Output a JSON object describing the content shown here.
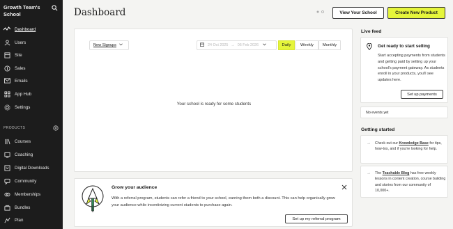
{
  "sidebar": {
    "school_name": "Growth Team's School",
    "items": [
      {
        "label": "Dashboard",
        "icon": "activity-icon",
        "active": true
      },
      {
        "label": "Users",
        "icon": "users-icon"
      },
      {
        "label": "Site",
        "icon": "site-icon"
      },
      {
        "label": "Sales",
        "icon": "sales-icon"
      },
      {
        "label": "Emails",
        "icon": "mail-icon"
      },
      {
        "label": "App Hub",
        "icon": "app-hub-icon"
      },
      {
        "label": "Settings",
        "icon": "gear-icon"
      }
    ],
    "products_header": "PRODUCTS",
    "products": [
      {
        "label": "Courses",
        "icon": "courses-icon"
      },
      {
        "label": "Coaching",
        "icon": "coaching-icon"
      },
      {
        "label": "Digital Downloads",
        "icon": "download-icon"
      },
      {
        "label": "Community",
        "icon": "community-icon"
      },
      {
        "label": "Memberships",
        "icon": "memberships-icon"
      },
      {
        "label": "Bundles",
        "icon": "bundles-icon"
      },
      {
        "label": "Plan",
        "icon": "plan-icon"
      }
    ]
  },
  "header": {
    "title": "Dashboard",
    "view_school": "View Your School",
    "create_product": "Create New Product"
  },
  "chart": {
    "metric": "New Signups",
    "date_start": "24 Oct 2025",
    "date_sep": "→",
    "date_end": "06 Feb 2026",
    "periods": [
      "Daily",
      "Weekly",
      "Monthly"
    ],
    "active_period": "Daily",
    "empty_message": "Your school is ready for some students"
  },
  "grow": {
    "title": "Grow your audience",
    "description": "With a referral program, students can refer a friend to your school, earning them both a discount. This can help organically grow your audience while incentivizing current students to purchase again.",
    "button": "Set up my referral program"
  },
  "live_feed": {
    "title": "Live feed",
    "card_title": "Get ready to start selling",
    "card_text": "Start accepting payments from students and getting paid by setting up your school's payment gateway. As students enroll in your products, you'll see updates here.",
    "card_button": "Set up payments",
    "events_text": "No events yet"
  },
  "getting_started": {
    "title": "Getting started",
    "item1_pre": "Check out our ",
    "item1_link": "Knowledge Base",
    "item1_post": " for tips, how-tos, and if you're looking for help.",
    "item2_pre": "The ",
    "item2_link": "Teachable Blog",
    "item2_post": " has free weekly lessons in content creation, course building and stories from our community of 10,000+."
  },
  "colors": {
    "accent": "#e5f53b",
    "sidebar_bg": "#1c1c1c",
    "page_bg": "#f4f4f2"
  }
}
